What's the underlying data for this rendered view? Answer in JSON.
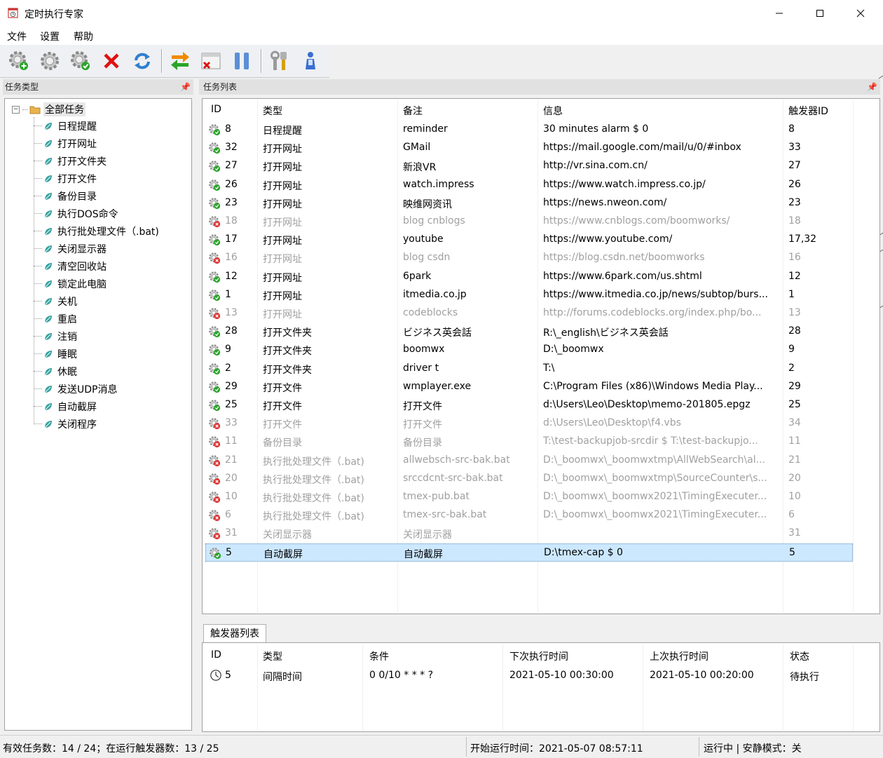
{
  "window": {
    "title": "定时执行专家"
  },
  "menu": [
    "文件",
    "设置",
    "帮助"
  ],
  "toolbar": [
    "add-task-icon",
    "edit-task-icon",
    "enable-task-icon",
    "delete-icon",
    "refresh-icon",
    "swap-icon",
    "disable-window-icon",
    "pause-icon",
    "tools-icon",
    "user-icon"
  ],
  "left_panel": {
    "header": "任务类型",
    "root": "全部任务",
    "items": [
      "日程提醒",
      "打开网址",
      "打开文件夹",
      "打开文件",
      "备份目录",
      "执行DOS命令",
      "执行批处理文件（.bat)",
      "关闭显示器",
      "清空回收站",
      "锁定此电脑",
      "关机",
      "重启",
      "注销",
      "睡眠",
      "休眠",
      "发送UDP消息",
      "自动截屏",
      "关闭程序"
    ]
  },
  "task_panel": {
    "header": "任务列表",
    "columns": [
      "ID",
      "类型",
      "备注",
      "信息",
      "触发器ID"
    ],
    "rows": [
      {
        "id": "8",
        "type": "日程提醒",
        "note": "reminder",
        "info": "30 minutes alarm $ 0",
        "trigger": "8",
        "state": "enabled"
      },
      {
        "id": "32",
        "type": "打开网址",
        "note": "GMail",
        "info": "https://mail.google.com/mail/u/0/#inbox",
        "trigger": "33",
        "state": "enabled"
      },
      {
        "id": "27",
        "type": "打开网址",
        "note": "新浪VR",
        "info": "http://vr.sina.com.cn/",
        "trigger": "27",
        "state": "enabled"
      },
      {
        "id": "26",
        "type": "打开网址",
        "note": "watch.impress",
        "info": "https://www.watch.impress.co.jp/",
        "trigger": "26",
        "state": "enabled"
      },
      {
        "id": "23",
        "type": "打开网址",
        "note": "映维网资讯",
        "info": "https://news.nweon.com/",
        "trigger": "23",
        "state": "enabled"
      },
      {
        "id": "18",
        "type": "打开网址",
        "note": "blog cnblogs",
        "info": "https://www.cnblogs.com/boomworks/",
        "trigger": "18",
        "state": "disabled"
      },
      {
        "id": "17",
        "type": "打开网址",
        "note": "youtube",
        "info": "https://www.youtube.com/",
        "trigger": "17,32",
        "state": "enabled"
      },
      {
        "id": "16",
        "type": "打开网址",
        "note": "blog csdn",
        "info": "https://blog.csdn.net/boomworks",
        "trigger": "16",
        "state": "disabled"
      },
      {
        "id": "12",
        "type": "打开网址",
        "note": "6park",
        "info": "https://www.6park.com/us.shtml",
        "trigger": "12",
        "state": "enabled"
      },
      {
        "id": "1",
        "type": "打开网址",
        "note": "itmedia.co.jp",
        "info": "https://www.itmedia.co.jp/news/subtop/burs...",
        "trigger": "1",
        "state": "enabled"
      },
      {
        "id": "13",
        "type": "打开网址",
        "note": "codeblocks",
        "info": "http://forums.codeblocks.org/index.php/bo...",
        "trigger": "13",
        "state": "disabled"
      },
      {
        "id": "28",
        "type": "打开文件夹",
        "note": "ビジネス英会話",
        "info": "R:\\_english\\ビジネス英会話",
        "trigger": "28",
        "state": "enabled"
      },
      {
        "id": "9",
        "type": "打开文件夹",
        "note": "boomwx",
        "info": "D:\\_boomwx",
        "trigger": "9",
        "state": "enabled"
      },
      {
        "id": "2",
        "type": "打开文件夹",
        "note": "driver t",
        "info": "T:\\",
        "trigger": "2",
        "state": "enabled"
      },
      {
        "id": "29",
        "type": "打开文件",
        "note": "wmplayer.exe",
        "info": "C:\\Program Files (x86)\\Windows Media Play...",
        "trigger": "29",
        "state": "enabled"
      },
      {
        "id": "25",
        "type": "打开文件",
        "note": "打开文件",
        "info": "d:\\Users\\Leo\\Desktop\\memo-201805.epgz",
        "trigger": "25",
        "state": "enabled"
      },
      {
        "id": "33",
        "type": "打开文件",
        "note": "打开文件",
        "info": "d:\\Users\\Leo\\Desktop\\f4.vbs",
        "trigger": "34",
        "state": "disabled"
      },
      {
        "id": "11",
        "type": "备份目录",
        "note": "备份目录",
        "info": "T:\\test-backupjob-srcdir $ T:\\test-backupjo...",
        "trigger": "11",
        "state": "disabled"
      },
      {
        "id": "21",
        "type": "执行批处理文件（.bat)",
        "note": "allwebsch-src-bak.bat",
        "info": "D:\\_boomwx\\_boomwxtmp\\AllWebSearch\\al...",
        "trigger": "21",
        "state": "disabled"
      },
      {
        "id": "20",
        "type": "执行批处理文件（.bat)",
        "note": "srccdcnt-src-bak.bat",
        "info": "D:\\_boomwx\\_boomwxtmp\\SourceCounter\\s...",
        "trigger": "20",
        "state": "disabled"
      },
      {
        "id": "10",
        "type": "执行批处理文件（.bat)",
        "note": "tmex-pub.bat",
        "info": "D:\\_boomwx\\_boomwx2021\\TimingExecuter...",
        "trigger": "10",
        "state": "disabled"
      },
      {
        "id": "6",
        "type": "执行批处理文件（.bat)",
        "note": "tmex-src-bak.bat",
        "info": "D:\\_boomwx\\_boomwx2021\\TimingExecuter...",
        "trigger": "6",
        "state": "disabled"
      },
      {
        "id": "31",
        "type": "关闭显示器",
        "note": "关闭显示器",
        "info": "",
        "trigger": "31",
        "state": "disabled"
      },
      {
        "id": "5",
        "type": "自动截屏",
        "note": "自动截屏",
        "info": "D:\\tmex-cap $ 0",
        "trigger": "5",
        "state": "selected"
      }
    ]
  },
  "trigger_panel": {
    "tab": "触发器列表",
    "columns": [
      "ID",
      "类型",
      "条件",
      "下次执行时间",
      "上次执行时间",
      "状态"
    ],
    "rows": [
      {
        "id": "5",
        "type": "间隔时间",
        "cond": "0 0/10 * * * ?",
        "next": "2021-05-10 00:30:00",
        "last": "2021-05-10 00:20:00",
        "status": "待执行"
      }
    ]
  },
  "statusbar": {
    "left": "有效任务数：14 / 24；在运行触发器数：13 / 25",
    "middle": "开始运行时间：2021-05-07 08:57:11",
    "right": "运行中 | 安静模式：关"
  },
  "colors": {
    "selected_row": "#cce8ff",
    "disabled_text": "#a0a0a0",
    "enabled_badge": "#2aa52a",
    "disabled_badge": "#e03030"
  }
}
